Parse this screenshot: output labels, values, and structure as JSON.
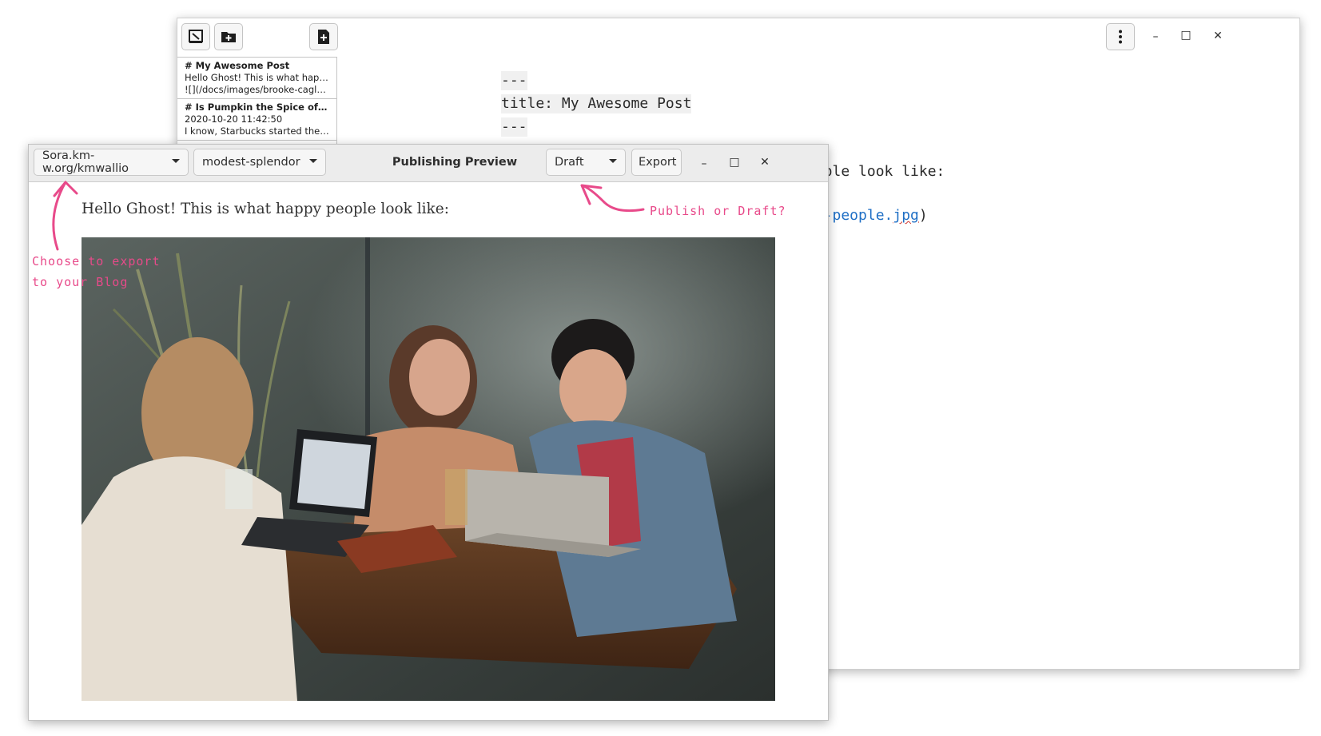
{
  "editor": {
    "notes": [
      {
        "title": "# My Awesome Post",
        "line1": "Hello Ghost! This is what happ...",
        "line2": "![](/docs/images/brooke-cagle..."
      },
      {
        "title": "# Is Pumpkin the Spice of Life?",
        "line1": "2020-10-20 11:42:50",
        "line2": "I know, Starbucks started the ..."
      }
    ],
    "markdown": {
      "front_open": "---",
      "title_line": "title: My Awesome Post",
      "front_close": "---",
      "body_visible": "eople look like:",
      "link_visible_before": "py-people.",
      "link_visible_misspelled": "jpg",
      "link_paren": ")"
    },
    "window_controls": {
      "minimize": "–",
      "maximize": "□",
      "close": "✕"
    }
  },
  "preview": {
    "blog_selector": "Sora.km-w.org/kmwallio",
    "theme_selector": "modest-splendor",
    "title": "Publishing Preview",
    "status_selector": "Draft",
    "export_label": "Export",
    "body_text": "Hello Ghost! This is what happy people look like:",
    "window_controls": {
      "minimize": "–",
      "maximize": "□",
      "close": "✕"
    }
  },
  "annotations": {
    "publish_hint": "Publish or Draft?",
    "export_hint_line1": "Choose to export",
    "export_hint_line2": "to your Blog"
  },
  "colors": {
    "annotation": "#e84a8a",
    "link": "#1f6fc5"
  },
  "icons": {
    "editor_buttons": [
      "sidebar-toggle-icon",
      "new-folder-icon",
      "new-document-icon",
      "menu-kebab-icon"
    ]
  }
}
